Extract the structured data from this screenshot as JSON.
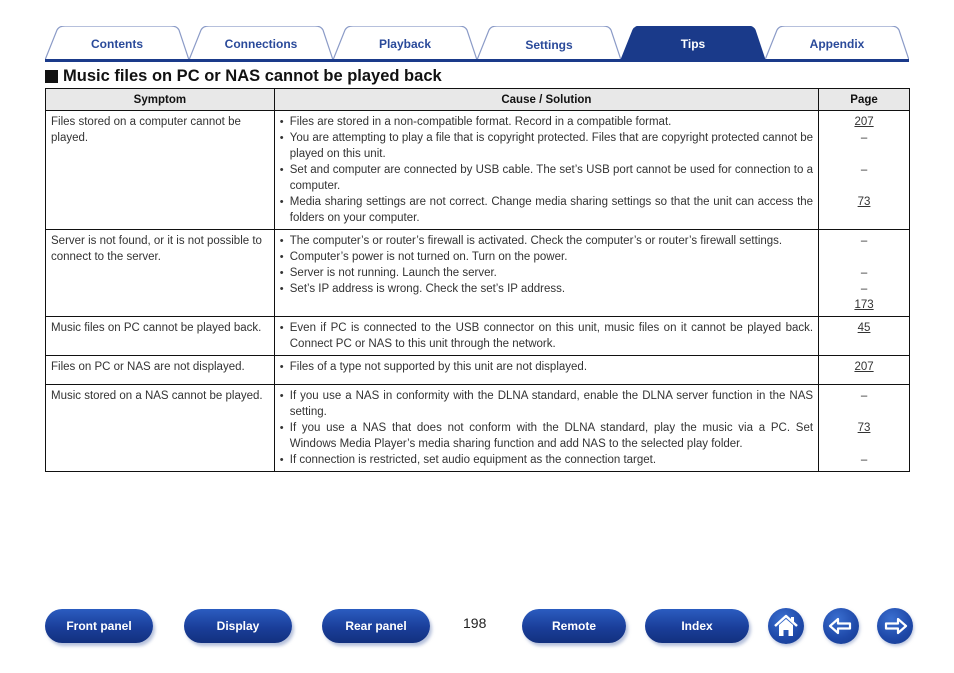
{
  "tabs": [
    {
      "label": "Contents",
      "active": false
    },
    {
      "label": "Connections",
      "active": false
    },
    {
      "label": "Playback",
      "active": false
    },
    {
      "label": "Settings",
      "active": false
    },
    {
      "label": "Tips",
      "active": true
    },
    {
      "label": "Appendix",
      "active": false
    }
  ],
  "colors": {
    "brand": "#1a3a8a",
    "tab_inactive_text": "#2a4a9a",
    "header_bg": "#e8e8e8"
  },
  "section": {
    "title": "Music files on PC or NAS cannot be played back",
    "icon": "black-square-icon"
  },
  "table": {
    "headers": {
      "symptom": "Symptom",
      "cause": "Cause / Solution",
      "page": "Page"
    },
    "rows": [
      {
        "symptom": "Files stored on a computer cannot be played.",
        "causes": [
          "Files are stored in a non-compatible format. Record in a compatible format.",
          "You are attempting to play a file that is copyright protected. Files that are copyright protected cannot be played on this unit.",
          "Set and computer are connected by USB cable. The set’s USB port cannot be used for connection to a computer.",
          "Media sharing settings are not correct. Change media sharing settings so that the unit can access the folders on your computer."
        ],
        "pages": [
          "207",
          "–",
          "–",
          "73"
        ]
      },
      {
        "symptom": "Server is not found, or it is not possible to connect to the server.",
        "causes": [
          "The computer’s or router’s firewall is activated. Check the computer’s or router’s firewall settings.",
          "Computer’s power is not turned on. Turn on the power.",
          "Server is not running. Launch the server.",
          "Set’s IP address is wrong. Check the set’s IP address."
        ],
        "pages": [
          "–",
          "–",
          "–",
          "173"
        ]
      },
      {
        "symptom": "Music files on PC cannot be played back.",
        "causes": [
          "Even if PC is connected to the USB connector on this unit, music files on it cannot be played back. Connect PC or NAS to this unit through the network."
        ],
        "pages": [
          "45"
        ]
      },
      {
        "symptom": "Files on PC or NAS are not displayed.",
        "causes": [
          "Files of a type not supported by this unit are not displayed."
        ],
        "pages": [
          "207"
        ]
      },
      {
        "symptom": "Music stored on a NAS cannot be played.",
        "causes": [
          "If you use a NAS in conformity with the DLNA standard, enable the DLNA server function in the NAS setting.",
          "If you use a NAS that does not conform with the DLNA standard, play the music via a PC. Set Windows Media Player’s media sharing function and add NAS to the selected play folder.",
          "If connection is restricted, set audio equipment as the connection target."
        ],
        "pages": [
          "–",
          "73",
          "–"
        ]
      }
    ]
  },
  "footer": {
    "buttons": [
      "Front panel",
      "Display",
      "Rear panel",
      "Remote",
      "Index"
    ],
    "page_number": "198",
    "icons": [
      "home-icon",
      "back-arrow-icon",
      "forward-arrow-icon"
    ]
  }
}
